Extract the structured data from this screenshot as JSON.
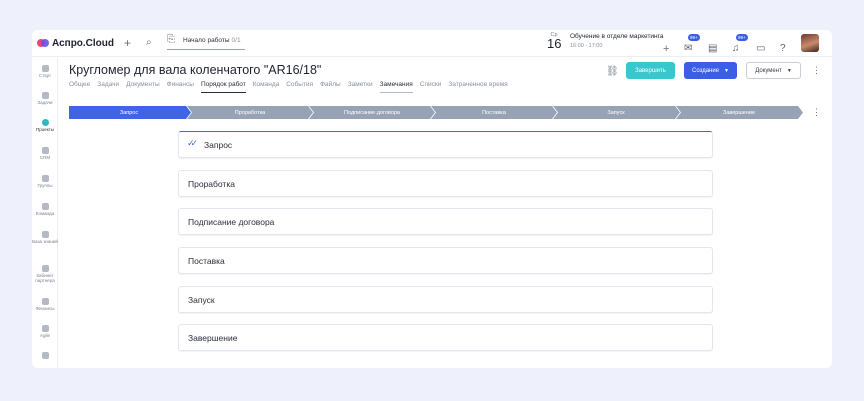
{
  "app": {
    "name": "Аспро.Cloud"
  },
  "topbar": {
    "work_label": "Начало работы",
    "work_count": "0/1",
    "date_dow": "Ср",
    "date_day": "16",
    "event_title": "Обучение в отделе маркетинга",
    "event_time": "16:00 - 17:00",
    "mail_badge": "99+",
    "bell_badge": "99+"
  },
  "sidebar": {
    "items": [
      {
        "label": "Старт"
      },
      {
        "label": "Задачи"
      },
      {
        "label": "Проекты"
      },
      {
        "label": "CRM"
      },
      {
        "label": "Группы"
      },
      {
        "label": "Команда"
      },
      {
        "label": "База знаний"
      },
      {
        "label": "Кабинет партнера"
      },
      {
        "label": "Финансы"
      },
      {
        "label": "Agile"
      }
    ]
  },
  "header": {
    "title": "Кругломер для вала коленчатого \"AR16/18\"",
    "finish_label": "Завершить",
    "create_label": "Создание",
    "doc_label": "Документ"
  },
  "tabs": [
    {
      "label": "Общее"
    },
    {
      "label": "Задачи"
    },
    {
      "label": "Документы"
    },
    {
      "label": "Финансы"
    },
    {
      "label": "Порядок работ"
    },
    {
      "label": "Команда"
    },
    {
      "label": "События"
    },
    {
      "label": "Файлы"
    },
    {
      "label": "Заметки"
    },
    {
      "label": "Замечания"
    },
    {
      "label": "Списки"
    },
    {
      "label": "Затраченное время"
    }
  ],
  "stages": [
    {
      "label": "Запрос"
    },
    {
      "label": "Проработка"
    },
    {
      "label": "Подписание договора"
    },
    {
      "label": "Поставка"
    },
    {
      "label": "Запуск"
    },
    {
      "label": "Завершение"
    }
  ],
  "sections": [
    {
      "label": "Запрос"
    },
    {
      "label": "Проработка"
    },
    {
      "label": "Подписание договора"
    },
    {
      "label": "Поставка"
    },
    {
      "label": "Запуск"
    },
    {
      "label": "Завершение"
    }
  ],
  "colors": {
    "accent": "#3f64e8",
    "finish": "#36c7cf",
    "stage_rest": "#97a3b5",
    "background": "#eef0fb"
  }
}
